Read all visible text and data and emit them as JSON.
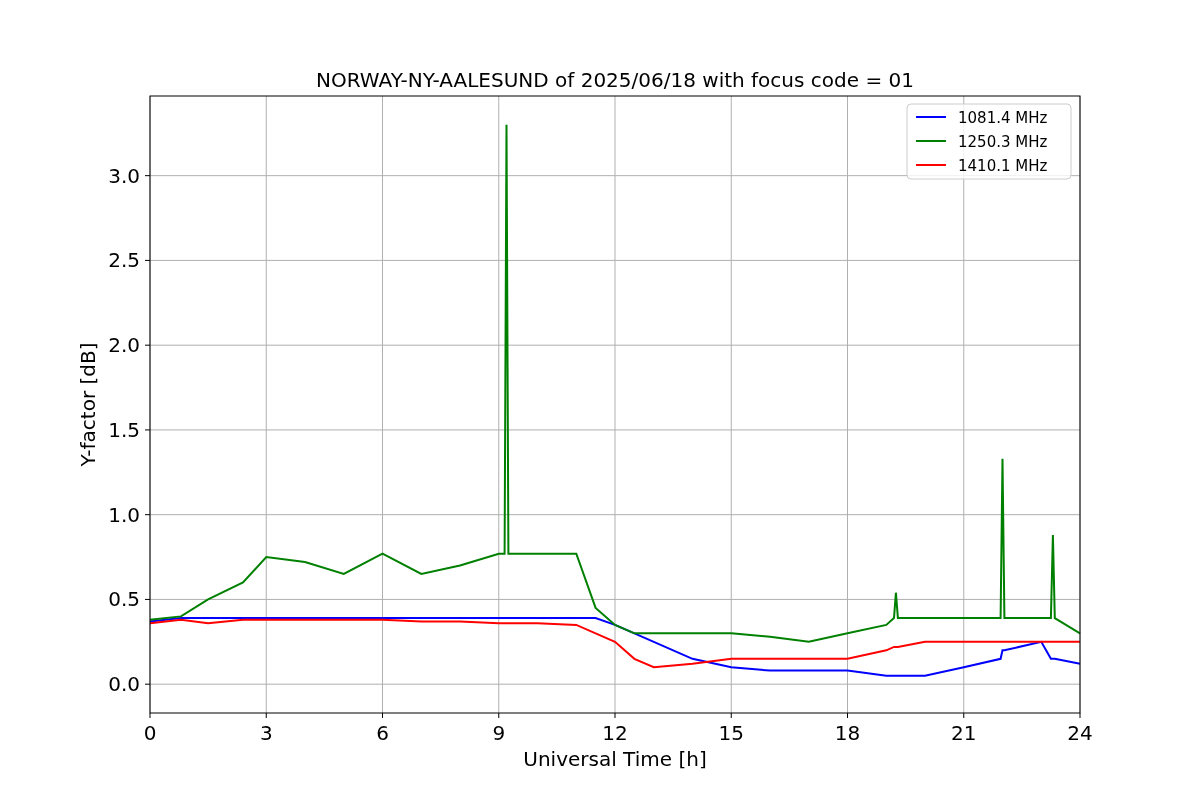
{
  "chart_data": {
    "type": "line",
    "title": "NORWAY-NY-AALESUND of 2025/06/18 with focus code = 01",
    "xlabel": "Universal Time [h]",
    "ylabel": "Y-factor [dB]",
    "x": [
      0,
      0.8,
      1.5,
      2.4,
      3,
      4,
      5,
      6,
      7,
      8,
      9,
      9.15,
      9.2,
      9.25,
      10,
      11,
      11.5,
      12,
      12.5,
      13,
      14,
      15,
      16,
      17,
      18,
      19,
      19.2,
      19.25,
      19.3,
      20,
      21,
      21.95,
      22,
      22.05,
      23,
      23.25,
      23.3,
      23.35,
      24
    ],
    "series": [
      {
        "name": "1081.4 MHz",
        "color": "#0000ff",
        "values": [
          0.37,
          0.39,
          0.39,
          0.39,
          0.39,
          0.39,
          0.39,
          0.39,
          0.39,
          0.39,
          0.39,
          0.39,
          0.39,
          0.39,
          0.39,
          0.39,
          0.39,
          0.35,
          0.3,
          0.25,
          0.15,
          0.1,
          0.08,
          0.08,
          0.08,
          0.05,
          0.05,
          0.05,
          0.05,
          0.05,
          0.1,
          0.15,
          0.2,
          0.2,
          0.25,
          0.15,
          0.15,
          0.15,
          0.12
        ]
      },
      {
        "name": "1250.3 MHz",
        "color": "#008000",
        "values": [
          0.38,
          0.4,
          0.5,
          0.6,
          0.75,
          0.72,
          0.65,
          0.77,
          0.65,
          0.7,
          0.77,
          0.77,
          3.3,
          0.77,
          0.77,
          0.77,
          0.45,
          0.35,
          0.3,
          0.3,
          0.3,
          0.3,
          0.28,
          0.25,
          0.3,
          0.35,
          0.39,
          0.54,
          0.39,
          0.39,
          0.39,
          0.39,
          1.33,
          0.39,
          0.39,
          0.39,
          0.88,
          0.39,
          0.3
        ]
      },
      {
        "name": "1410.1 MHz",
        "color": "#ff0000",
        "values": [
          0.36,
          0.38,
          0.36,
          0.38,
          0.38,
          0.38,
          0.38,
          0.38,
          0.37,
          0.37,
          0.36,
          0.36,
          0.36,
          0.36,
          0.36,
          0.35,
          0.3,
          0.25,
          0.15,
          0.1,
          0.12,
          0.15,
          0.15,
          0.15,
          0.15,
          0.2,
          0.22,
          0.22,
          0.22,
          0.25,
          0.25,
          0.25,
          0.25,
          0.25,
          0.25,
          0.25,
          0.25,
          0.25,
          0.25
        ]
      }
    ],
    "grid": true,
    "legend": "upper right",
    "xlim": [
      0,
      24
    ],
    "ylim": [
      -0.17,
      3.47
    ],
    "xticks": [
      0,
      3,
      6,
      9,
      12,
      15,
      18,
      21,
      24
    ],
    "yticks": [
      {
        "value": 0,
        "label": "0.0"
      },
      {
        "value": 0.5,
        "label": "0.5"
      },
      {
        "value": 1,
        "label": "1.0"
      },
      {
        "value": 1.5,
        "label": "1.5"
      },
      {
        "value": 2,
        "label": "2.0"
      },
      {
        "value": 2.5,
        "label": "2.5"
      },
      {
        "value": 3,
        "label": "3.0"
      }
    ]
  }
}
